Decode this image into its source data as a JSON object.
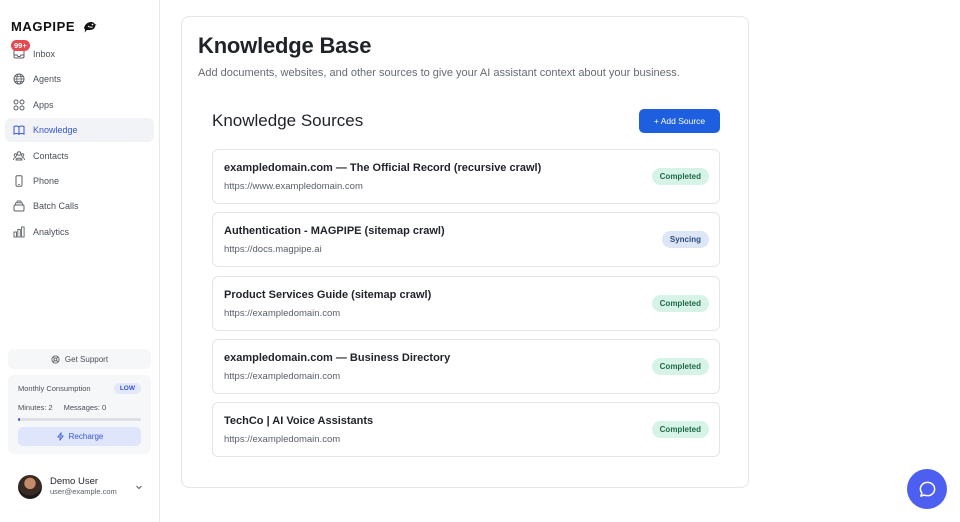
{
  "app": {
    "logo_text": "MAGPIPE"
  },
  "sidebar": {
    "items": [
      {
        "label": "Inbox",
        "icon": "inbox-icon",
        "badge": "99+"
      },
      {
        "label": "Agents",
        "icon": "globe-icon"
      },
      {
        "label": "Apps",
        "icon": "grid-icon"
      },
      {
        "label": "Knowledge",
        "icon": "book-icon",
        "active": true
      },
      {
        "label": "Contacts",
        "icon": "contacts-icon"
      },
      {
        "label": "Phone",
        "icon": "phone-icon"
      },
      {
        "label": "Batch Calls",
        "icon": "batch-icon"
      },
      {
        "label": "Analytics",
        "icon": "chart-icon"
      }
    ],
    "support_label": "Get Support",
    "consumption": {
      "label": "Monthly Consumption",
      "level": "LOW",
      "minutes": "Minutes: 2",
      "messages": "Messages: 0",
      "usage_fraction": 0.02,
      "recharge_label": "Recharge"
    },
    "user": {
      "name": "Demo User",
      "email": "user@example.com"
    }
  },
  "main": {
    "title": "Knowledge Base",
    "subtitle": "Add documents, websites, and other sources to give your AI assistant context about your business.",
    "section_title": "Knowledge Sources",
    "add_button": "+ Add Source",
    "sources": [
      {
        "name": "exampledomain.com — The Official Record (recursive crawl)",
        "url": "https://www.exampledomain.com",
        "status": "Completed"
      },
      {
        "name": "Authentication - MAGPIPE (sitemap crawl)",
        "url": "https://docs.magpipe.ai",
        "status": "Syncing"
      },
      {
        "name": "Product Services Guide (sitemap crawl)",
        "url": "https://exampledomain.com",
        "status": "Completed"
      },
      {
        "name": "exampledomain.com — Business Directory",
        "url": "https://exampledomain.com",
        "status": "Completed"
      },
      {
        "name": "TechCo | AI Voice Assistants",
        "url": "https://exampledomain.com",
        "status": "Completed"
      }
    ]
  },
  "colors": {
    "accent": "#1d5fdf",
    "active_nav": "#3556d8",
    "completed_bg": "#d7f2e6",
    "syncing_bg": "#dce6f7",
    "fab": "#4d5ff0"
  }
}
